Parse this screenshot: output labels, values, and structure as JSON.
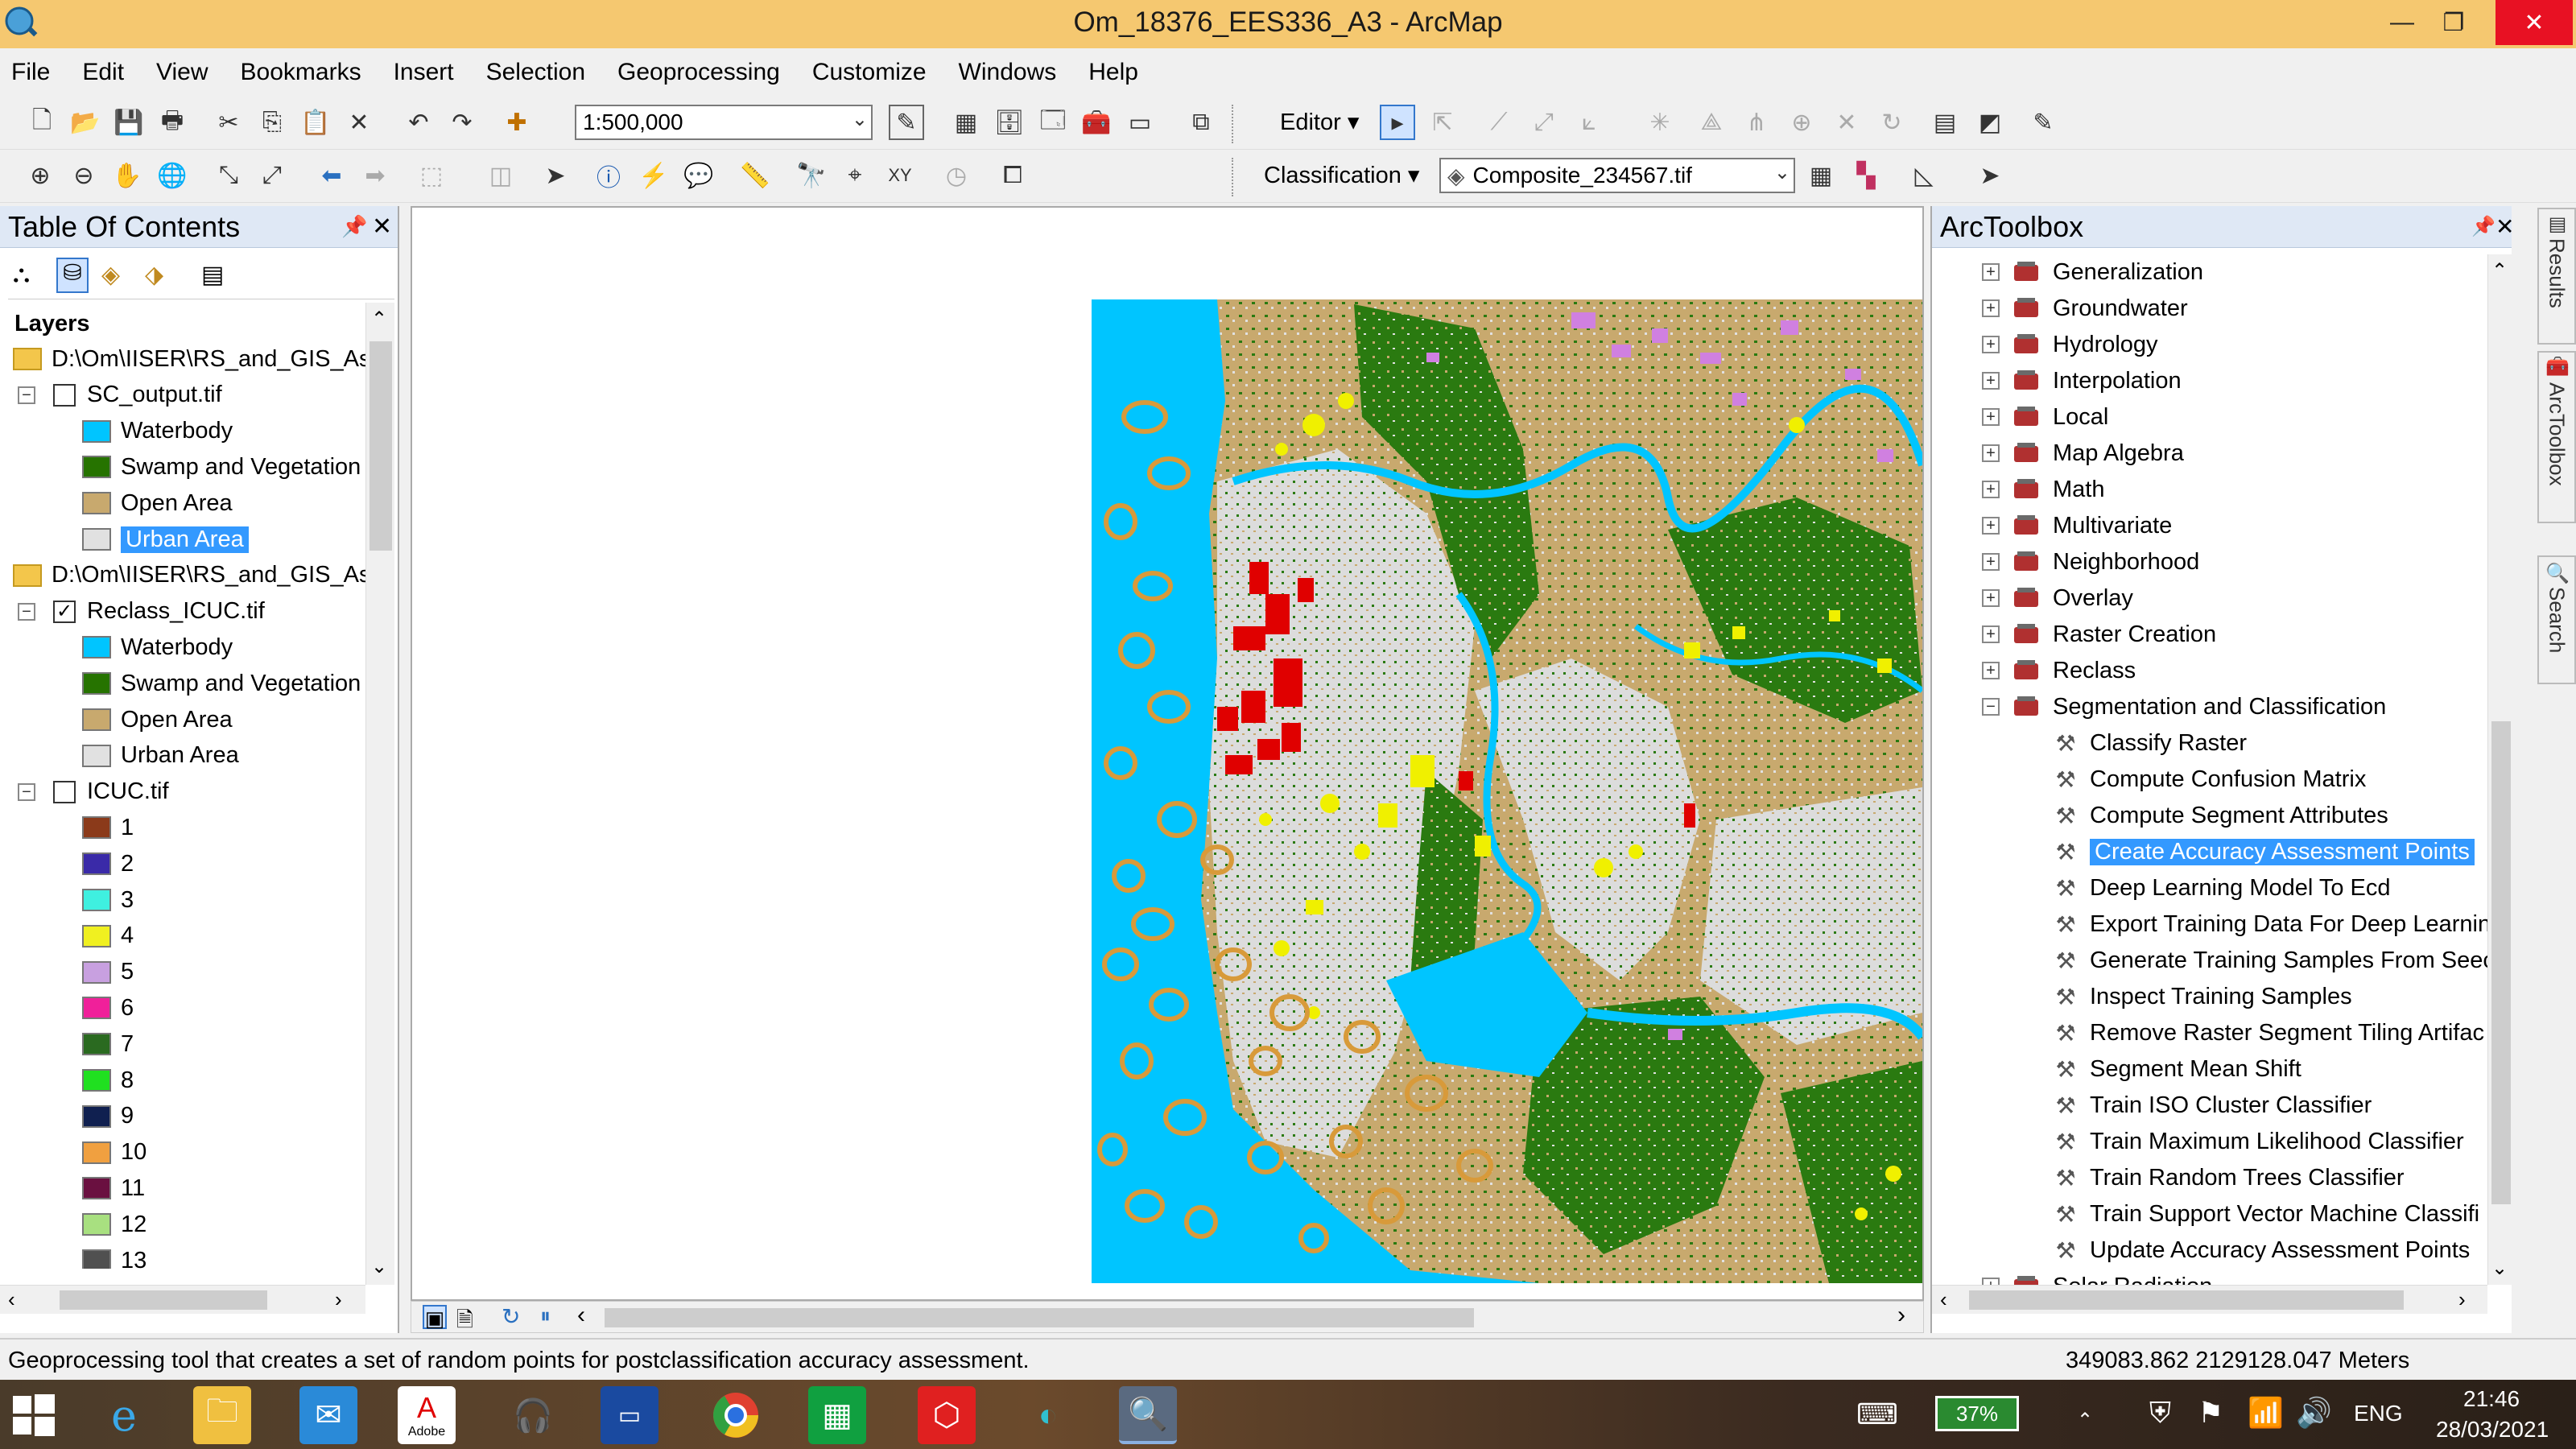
{
  "window": {
    "title": "Om_18376_EES336_A3 - ArcMap",
    "min": "—",
    "restore": "❐",
    "close": "✕"
  },
  "menu": [
    "File",
    "Edit",
    "View",
    "Bookmarks",
    "Insert",
    "Selection",
    "Geoprocessing",
    "Customize",
    "Windows",
    "Help"
  ],
  "toolbar": {
    "scale": "1:500,000",
    "editor": "Editor ▾",
    "classification": "Classification ▾",
    "composite": "Composite_234567.tif"
  },
  "toc": {
    "title": "Table Of Contents",
    "root": "Layers",
    "items": [
      {
        "kind": "folder",
        "label": "D:\\Om\\IISER\\RS_and_GIS_Ass"
      },
      {
        "kind": "layer",
        "label": "SC_output.tif",
        "checked": false
      },
      {
        "kind": "class",
        "label": "Waterbody",
        "color": "#00c5ff"
      },
      {
        "kind": "class",
        "label": "Swamp and Vegetation",
        "color": "#267300"
      },
      {
        "kind": "class",
        "label": "Open Area",
        "color": "#c8a96e"
      },
      {
        "kind": "class",
        "label": "Urban Area",
        "color": "#e1e1e1",
        "selected": true
      },
      {
        "kind": "folder",
        "label": "D:\\Om\\IISER\\RS_and_GIS_Ass"
      },
      {
        "kind": "layer",
        "label": "Reclass_ICUC.tif",
        "checked": true
      },
      {
        "kind": "class",
        "label": "Waterbody",
        "color": "#00c5ff"
      },
      {
        "kind": "class",
        "label": "Swamp and Vegetation",
        "color": "#267300"
      },
      {
        "kind": "class",
        "label": "Open Area",
        "color": "#c8a96e"
      },
      {
        "kind": "class",
        "label": "Urban Area",
        "color": "#e1e1e1"
      },
      {
        "kind": "layer",
        "label": "ICUC.tif",
        "checked": false
      },
      {
        "kind": "class",
        "label": "1",
        "color": "#8b3a1a"
      },
      {
        "kind": "class",
        "label": "2",
        "color": "#3a2aa8"
      },
      {
        "kind": "class",
        "label": "3",
        "color": "#3ff0e0"
      },
      {
        "kind": "class",
        "label": "4",
        "color": "#f0f020"
      },
      {
        "kind": "class",
        "label": "5",
        "color": "#c8a0e0"
      },
      {
        "kind": "class",
        "label": "6",
        "color": "#f0209a"
      },
      {
        "kind": "class",
        "label": "7",
        "color": "#2a6a20"
      },
      {
        "kind": "class",
        "label": "8",
        "color": "#20e020"
      },
      {
        "kind": "class",
        "label": "9",
        "color": "#102050"
      },
      {
        "kind": "class",
        "label": "10",
        "color": "#f0a040"
      },
      {
        "kind": "class",
        "label": "11",
        "color": "#6a1040"
      },
      {
        "kind": "class",
        "label": "12",
        "color": "#a8e080"
      },
      {
        "kind": "class",
        "label": "13",
        "color": "#505050"
      }
    ]
  },
  "toolbox": {
    "title": "ArcToolbox",
    "items": [
      {
        "kind": "toolset",
        "label": "Generalization"
      },
      {
        "kind": "toolset",
        "label": "Groundwater"
      },
      {
        "kind": "toolset",
        "label": "Hydrology"
      },
      {
        "kind": "toolset",
        "label": "Interpolation"
      },
      {
        "kind": "toolset",
        "label": "Local"
      },
      {
        "kind": "toolset",
        "label": "Map Algebra"
      },
      {
        "kind": "toolset",
        "label": "Math"
      },
      {
        "kind": "toolset",
        "label": "Multivariate"
      },
      {
        "kind": "toolset",
        "label": "Neighborhood"
      },
      {
        "kind": "toolset",
        "label": "Overlay"
      },
      {
        "kind": "toolset",
        "label": "Raster Creation"
      },
      {
        "kind": "toolset",
        "label": "Reclass"
      },
      {
        "kind": "toolset",
        "label": "Segmentation and Classification",
        "expanded": true
      },
      {
        "kind": "tool",
        "label": "Classify Raster"
      },
      {
        "kind": "tool",
        "label": "Compute Confusion Matrix"
      },
      {
        "kind": "tool",
        "label": "Compute Segment Attributes"
      },
      {
        "kind": "tool",
        "label": "Create Accuracy Assessment Points",
        "selected": true
      },
      {
        "kind": "tool",
        "label": "Deep Learning Model To Ecd"
      },
      {
        "kind": "tool",
        "label": "Export Training Data For Deep Learnin"
      },
      {
        "kind": "tool",
        "label": "Generate Training Samples From Seec"
      },
      {
        "kind": "tool",
        "label": "Inspect Training Samples"
      },
      {
        "kind": "tool",
        "label": "Remove Raster Segment Tiling Artifac"
      },
      {
        "kind": "tool",
        "label": "Segment Mean Shift"
      },
      {
        "kind": "tool",
        "label": "Train ISO Cluster Classifier"
      },
      {
        "kind": "tool",
        "label": "Train Maximum Likelihood Classifier"
      },
      {
        "kind": "tool",
        "label": "Train Random Trees Classifier"
      },
      {
        "kind": "tool",
        "label": "Train Support Vector Machine Classifi"
      },
      {
        "kind": "tool",
        "label": "Update Accuracy Assessment Points"
      },
      {
        "kind": "toolset",
        "label": "Solar Radiation"
      }
    ]
  },
  "sidetabs": [
    "Results",
    "ArcToolbox",
    "Search"
  ],
  "status": {
    "message": "Geoprocessing tool that creates a set of random points for postclassification accuracy assessment.",
    "coords": "349083.862  2129128.047 Meters"
  },
  "taskbar": {
    "battery": "37%",
    "lang": "ENG",
    "time": "21:46",
    "date": "28/03/2021",
    "adobe": "Adobe"
  }
}
